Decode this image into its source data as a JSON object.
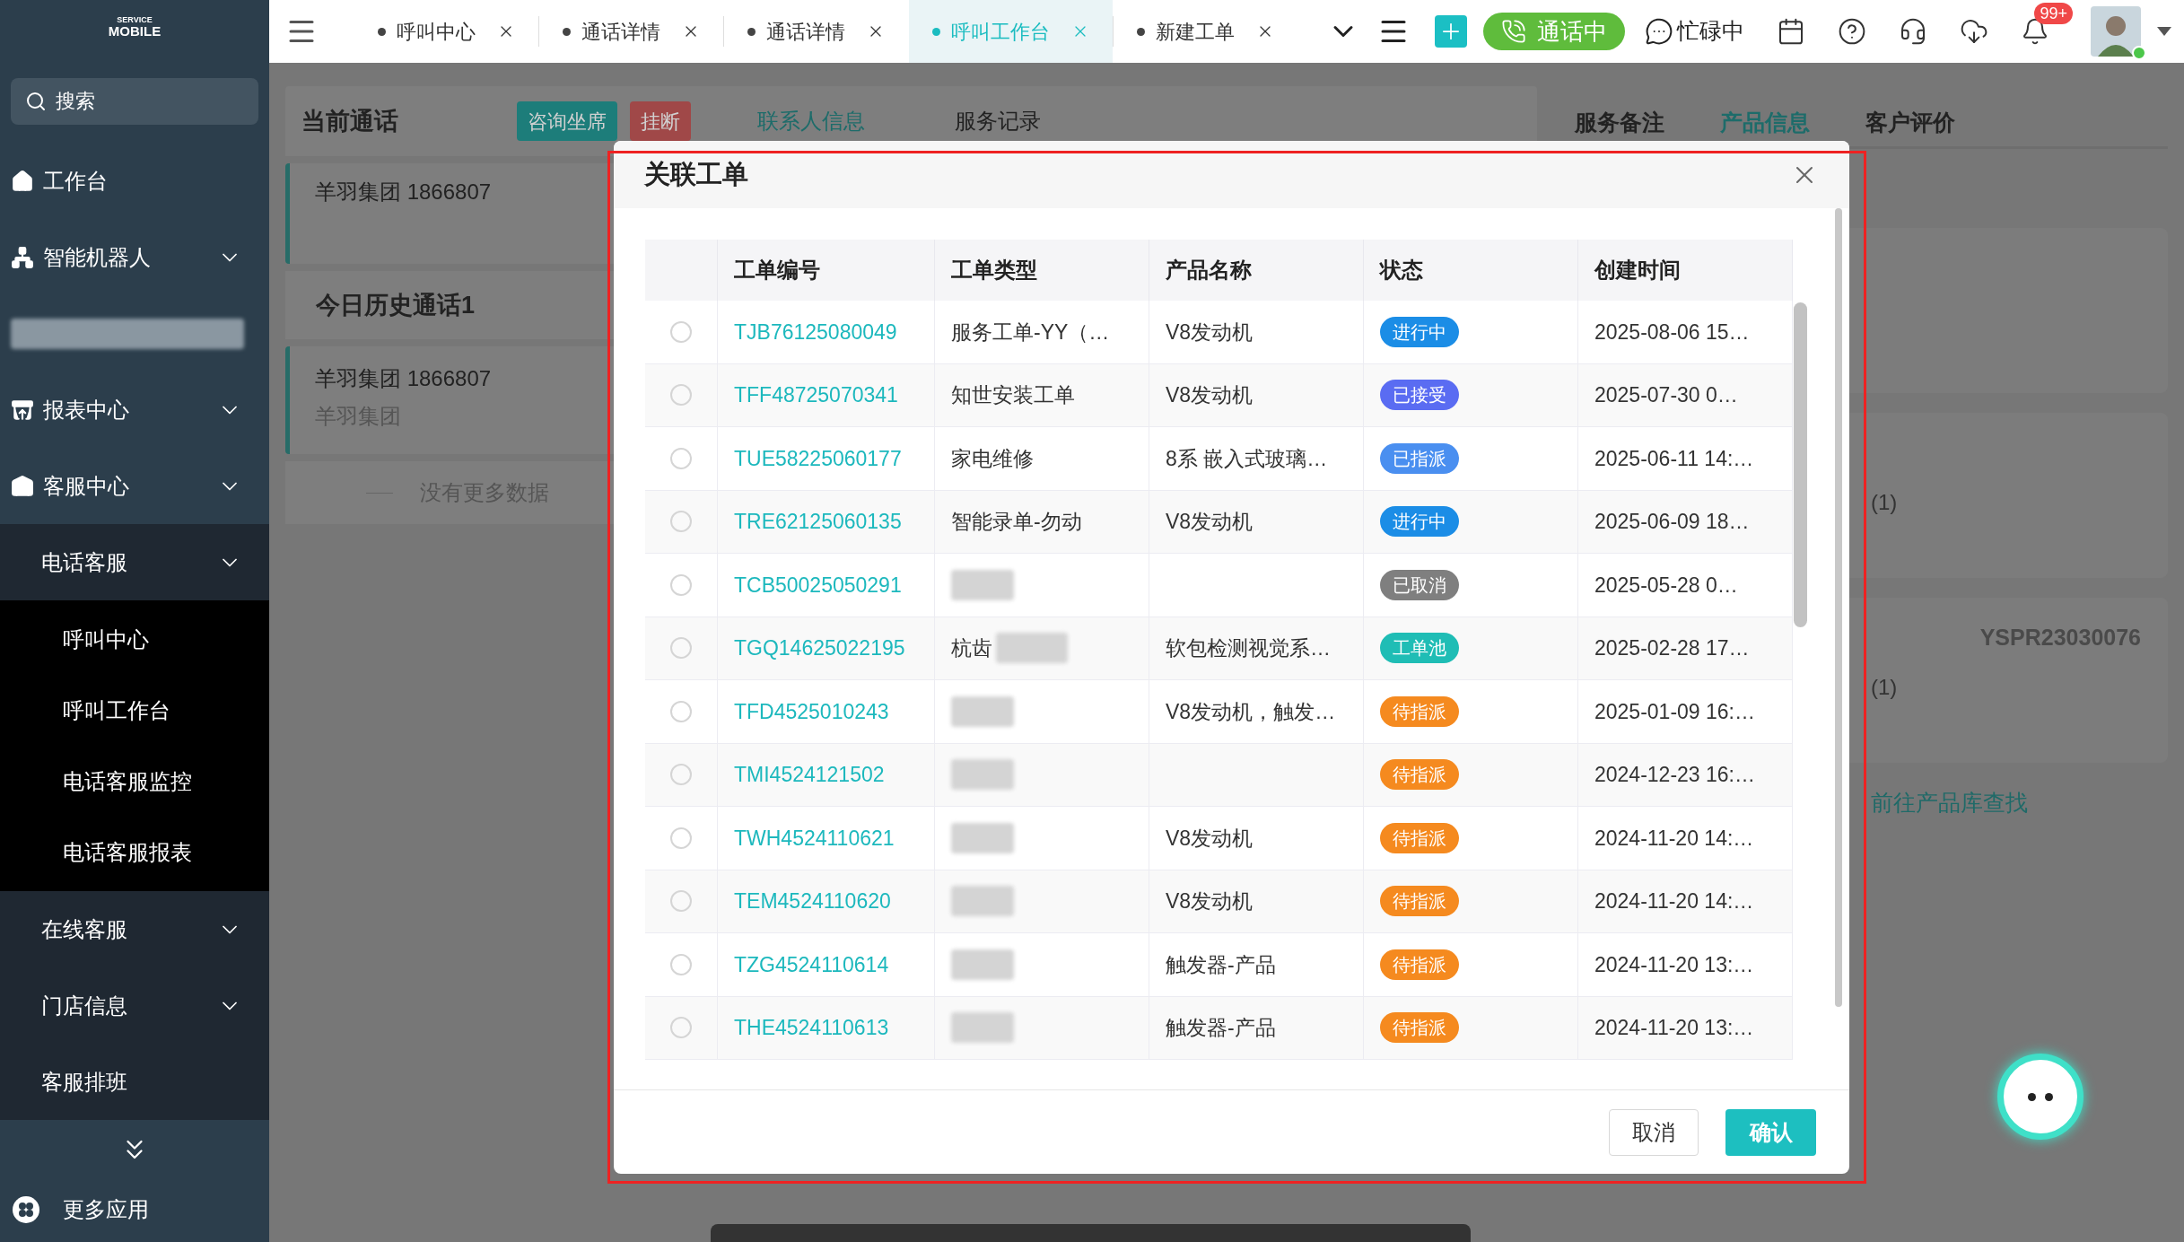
{
  "sidebar": {
    "logo_top": "SERVICE",
    "logo_main": "MOBILE",
    "search": {
      "placeholder": "搜索"
    },
    "items": [
      {
        "kind": "item",
        "label": "工作台"
      },
      {
        "kind": "menu",
        "label": "智能机器人"
      },
      {
        "kind": "redacted"
      },
      {
        "kind": "menu",
        "label": "报表中心"
      },
      {
        "kind": "menu",
        "label": "客服中心"
      },
      {
        "kind": "group",
        "label": "电话客服",
        "expanded": true,
        "children": [
          {
            "label": "呼叫中心"
          },
          {
            "label": "呼叫工作台"
          },
          {
            "label": "电话客服监控"
          },
          {
            "label": "电话客服报表"
          }
        ]
      },
      {
        "kind": "group",
        "label": "在线客服"
      },
      {
        "kind": "group",
        "label": "门店信息"
      },
      {
        "kind": "group_link",
        "label": "客服排班"
      }
    ],
    "more_apps": "更多应用"
  },
  "tabs": [
    {
      "label": "呼叫中心",
      "selected": false
    },
    {
      "label": "通话详情",
      "selected": false
    },
    {
      "label": "通话详情",
      "selected": false
    },
    {
      "label": "呼叫工作台",
      "selected": true
    },
    {
      "label": "新建工单",
      "selected": false
    }
  ],
  "toolbar": {
    "call_status": "通话中",
    "agent_status": "忙碌中",
    "notification_count": "99+"
  },
  "current_call": {
    "title": "当前通话",
    "buttons": [
      {
        "label": "咨询坐席",
        "color": "#1d7d7a"
      },
      {
        "label": "挂断",
        "color": "#a04848"
      }
    ],
    "tabs": [
      {
        "label": "联系人信息",
        "selected": true
      },
      {
        "label": "服务记录",
        "selected": false
      }
    ],
    "call": "羊羽集团 1866807",
    "history_title": "今日历史通话1",
    "history": [
      {
        "line": "羊羽集团 1866807",
        "company": "羊羽集团"
      }
    ],
    "end_note": "没有更多数据"
  },
  "detail_panel": {
    "tabs": [
      {
        "label": "服务备注",
        "selected": false
      },
      {
        "label": "产品信息",
        "selected": true
      },
      {
        "label": "客户评价",
        "selected": false
      }
    ],
    "cards": [
      {
        "kind": "blank"
      },
      {
        "kind": "product",
        "count": "(1)"
      },
      {
        "kind": "product",
        "code": "YSPR23030076",
        "count": "(1)"
      }
    ],
    "link": "前往产品库查找"
  },
  "dialog": {
    "title": "关联工单",
    "columns": [
      "工单编号",
      "工单类型",
      "产品名称",
      "状态",
      "创建时间"
    ],
    "rows": [
      {
        "selected": false,
        "id": "TJB76125080049",
        "type": "服务工单-YY（…",
        "product": "V8发动机",
        "status": {
          "label": "进行中",
          "color": "#1b8de6"
        },
        "time": "2025-08-06 15…"
      },
      {
        "selected": false,
        "id": "TFF48725070341",
        "type": "知世安装工单",
        "product": "V8发动机",
        "status": {
          "label": "已接受",
          "color": "#5a6cf2"
        },
        "time": "2025-07-30 0…"
      },
      {
        "selected": false,
        "id": "TUE58225060177",
        "type": "家电维修",
        "product": "8系 嵌入式玻璃…",
        "status": {
          "label": "已指派",
          "color": "#4a8ff0"
        },
        "time": "2025-06-11 14:…"
      },
      {
        "selected": false,
        "id": "TRE62125060135",
        "type": "智能录单-勿动",
        "product": "V8发动机",
        "status": {
          "label": "进行中",
          "color": "#1b8de6"
        },
        "time": "2025-06-09 18…"
      },
      {
        "selected": false,
        "id": "TCB50025050291",
        "type_redacted": true,
        "status": {
          "label": "已取消",
          "color": "#7f7f7f"
        },
        "time": "2025-05-28 0…"
      },
      {
        "selected": false,
        "id": "TGQ14625022195",
        "type": "杭齿",
        "type_redacted": true,
        "product": "软包检测视觉系…",
        "status": {
          "label": "工单池",
          "color": "#1fbdb5"
        },
        "time": "2025-02-28 17…"
      },
      {
        "selected": false,
        "id": "TFD4525010243",
        "type_redacted": true,
        "product": "V8发动机，触发…",
        "status": {
          "label": "待指派",
          "color": "#f58a1f"
        },
        "time": "2025-01-09 16:…"
      },
      {
        "selected": false,
        "id": "TMI4524121502",
        "type_redacted": true,
        "status": {
          "label": "待指派",
          "color": "#f58a1f"
        },
        "time": "2024-12-23 16:…"
      },
      {
        "selected": false,
        "id": "TWH4524110621",
        "type_redacted": true,
        "product": "V8发动机",
        "status": {
          "label": "待指派",
          "color": "#f58a1f"
        },
        "time": "2024-11-20 14:…"
      },
      {
        "selected": false,
        "id": "TEM4524110620",
        "type_redacted": true,
        "product": "V8发动机",
        "status": {
          "label": "待指派",
          "color": "#f58a1f"
        },
        "time": "2024-11-20 14:…"
      },
      {
        "selected": false,
        "id": "TZG4524110614",
        "type_redacted": true,
        "product": "触发器-产品",
        "status": {
          "label": "待指派",
          "color": "#f58a1f"
        },
        "time": "2024-11-20 13:…"
      },
      {
        "selected": false,
        "id": "THE4524110613",
        "type_redacted": true,
        "product": "触发器-产品",
        "status": {
          "label": "待指派",
          "color": "#f58a1f"
        },
        "time": "2024-11-20 13:…"
      }
    ],
    "cancel": "取消",
    "confirm": "确认"
  }
}
